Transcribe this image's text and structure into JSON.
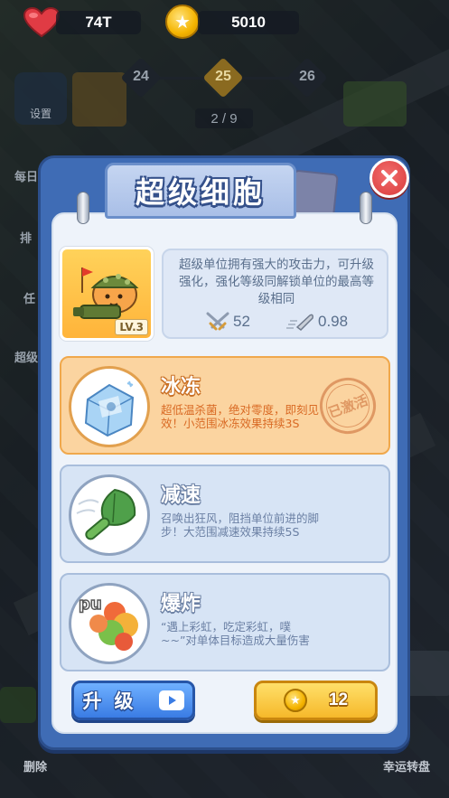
{
  "hud": {
    "hearts": "74T",
    "coins": "5010"
  },
  "level_track": {
    "prev": "24",
    "current": "25",
    "next": "26"
  },
  "page_indicator": "2 / 9",
  "side_menu": {
    "settings_label": "设置",
    "daily_label": "每日",
    "rank_label": "排",
    "task_label": "任",
    "super_label": "超级"
  },
  "panel": {
    "title": "超级细胞",
    "close_icon": "close-icon",
    "hero": {
      "level": "LV.3",
      "description": "超级单位拥有强大的攻击力，可升级强化，强化等级同解锁单位的最高等级相同",
      "attack": "52",
      "attack_speed": "0.98"
    },
    "skills": [
      {
        "name": "冰冻",
        "description": "超低温杀菌，绝对零度，即刻见效！小范围冰冻效果持续3S",
        "stamp": "已激活",
        "active": true
      },
      {
        "name": "减速",
        "description": "召唤出狂风，阻挡单位前进的脚步！大范围减速效果持续5S",
        "active": false
      },
      {
        "name": "爆炸",
        "description": "“遇上彩虹，吃定彩虹，噗~~”对单体目标造成大量伤害",
        "active": false
      }
    ],
    "buttons": {
      "upgrade_label": "升级",
      "cost": "12"
    }
  },
  "bottom": {
    "left_label": "删除",
    "right_label": "幸运转盘"
  },
  "colors": {
    "panel_blue": "#3f6cb5",
    "active_orange": "#fbd4a0",
    "close_red": "#d93a3a",
    "coin_gold": "#f5b400"
  }
}
